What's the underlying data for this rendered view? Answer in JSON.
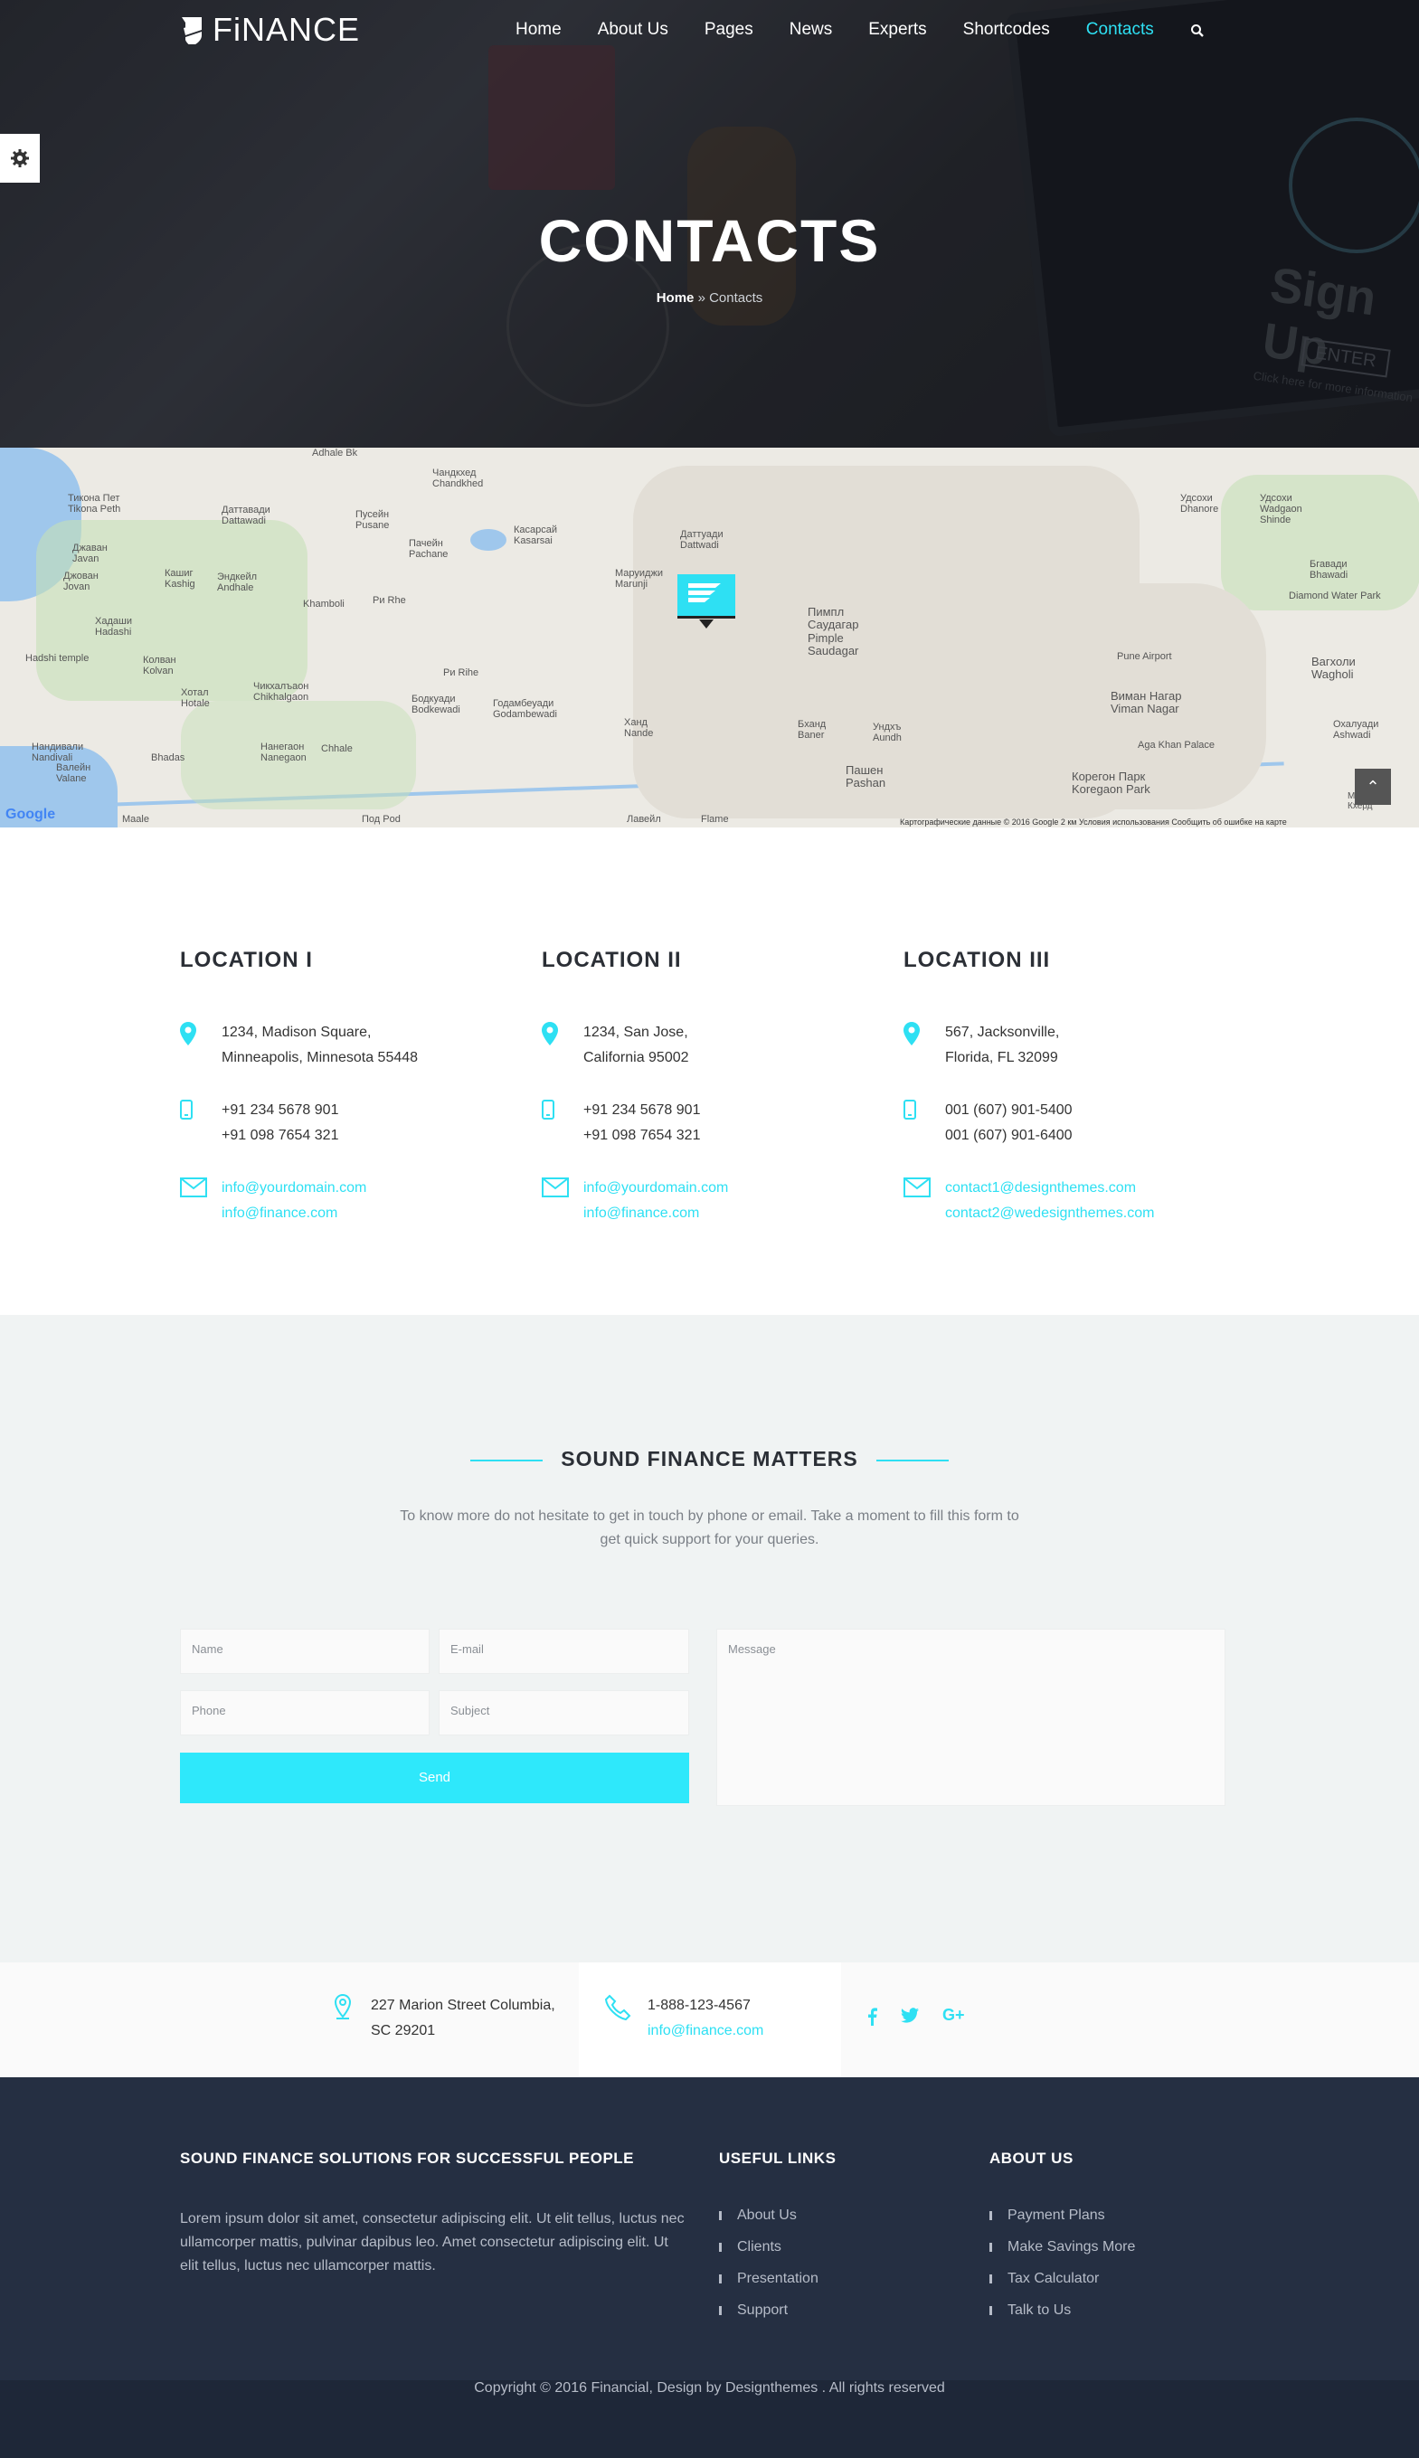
{
  "header": {
    "logo_text": "FiNANCE",
    "nav": [
      "Home",
      "About Us",
      "Pages",
      "News",
      "Experts",
      "Shortcodes",
      "Contacts"
    ],
    "active_nav": "Contacts",
    "search_icon": "search-icon"
  },
  "hero": {
    "title": "CONTACTS",
    "breadcrumb_home": "Home",
    "breadcrumb_sep": "»",
    "breadcrumb_current": "Contacts",
    "bg_text_signup": "Sign Up",
    "bg_text_enter": "ENTER",
    "bg_text_hint": "Click here for more information"
  },
  "map": {
    "labels": [
      "Adhale Bk",
      "Чандкхед Chandkhed",
      "Тиконa Пет Tikona Peth",
      "Даттавади Dattawadi",
      "Пусейн Pusane",
      "Пачейн Pachane",
      "Касарсай Kasarsai",
      "Даттуади Dattwadi",
      "Пимпл Саудагар Pimple Saudagar",
      "Маруиджи Marunji",
      "Джаван Javan",
      "Джован Jovan",
      "Кашиг Kashig",
      "Эндкейл Andhale",
      "Khamboli",
      "Ри Rhe",
      "Хадаши Hadashi",
      "Hadshi temple",
      "Колван Kolvan",
      "Хотал Hotale",
      "Чикхалъаон Chikhalgaon",
      "Ри Rihe",
      "Бодкуади Bodkewadi",
      "Годамбеуади Godambewadi",
      "Ханд Nande",
      "Бханд Baner",
      "Пашен Pashan",
      "Ундхъ Aundh",
      "Нанегаон Nanegaon",
      "Chhale",
      "Bhadas",
      "Валейн Valane",
      "Нандивали Nandivali",
      "Maale",
      "Под Pod",
      "Лавейл",
      "Flame",
      "Удсохи Dhanore",
      "Удсохи Wadgaon Shinde",
      "Бгавади Bhawadi",
      "Diamond Water Park",
      "Вагхоли Wagholi",
      "Pune Airport",
      "Виман Нагар Viman Nagar",
      "Aga Khan Palace",
      "Охалуади Ashwadi",
      "Корегон Парк Koregaon Park",
      "Мамжари Кхерд"
    ],
    "google": "Google",
    "attribution": "Картографические данные © 2016 Google   2 км   Условия использования   Сообщить об ошибке на карте"
  },
  "locations": [
    {
      "title": "LOCATION I",
      "address": [
        "1234, Madison Square,",
        "Minneapolis, Minnesota 55448"
      ],
      "phones": [
        "+91 234 5678 901",
        "+91 098 7654 321"
      ],
      "emails": [
        "info@yourdomain.com",
        "info@finance.com"
      ]
    },
    {
      "title": "LOCATION II",
      "address": [
        "1234, San Jose,",
        "California 95002"
      ],
      "phones": [
        "+91 234 5678 901",
        "+91 098 7654 321"
      ],
      "emails": [
        "info@yourdomain.com",
        "info@finance.com"
      ]
    },
    {
      "title": "LOCATION III",
      "address": [
        "567, Jacksonville,",
        "Florida, FL 32099"
      ],
      "phones": [
        "001 (607) 901-5400",
        "001 (607) 901-6400"
      ],
      "emails": [
        "contact1@designthemes.com",
        "contact2@wedesignthemes.com"
      ]
    }
  ],
  "contact_section": {
    "title": "SOUND FINANCE MATTERS",
    "subtitle": "To know more do not hesitate to get in touch by phone or email. Take a moment to fill this form to get quick support for your queries.",
    "name_placeholder": "Name",
    "email_placeholder": "E-mail",
    "phone_placeholder": "Phone",
    "subject_placeholder": "Subject",
    "message_placeholder": "Message",
    "send_label": "Send"
  },
  "strip": {
    "address": [
      "227 Marion Street Columbia,",
      "SC 29201"
    ],
    "phone": "1-888-123-4567",
    "email": "info@finance.com",
    "social": [
      "f",
      "t",
      "G+"
    ]
  },
  "footer": {
    "col1_title": "SOUND FINANCE SOLUTIONS FOR SUCCESSFUL PEOPLE",
    "col1_text": "Lorem ipsum dolor sit amet, consectetur adipiscing elit. Ut elit tellus, luctus nec ullamcorper mattis, pulvinar dapibus leo. Amet consectetur adipiscing elit. Ut elit tellus, luctus nec ullamcorper mattis.",
    "col2_title": "USEFUL LINKS",
    "col2_links": [
      "About Us",
      "Clients",
      "Presentation",
      "Support"
    ],
    "col3_title": "ABOUT US",
    "col3_links": [
      "Payment Plans",
      "Make Savings More",
      "Tax Calculator",
      "Talk to Us"
    ],
    "copyright": "Copyright © 2016 Financial, Design by Designthemes . All rights reserved"
  },
  "colors": {
    "accent": "#2ee0f3",
    "footer_bg": "#252f42",
    "copy_bg": "#1e2738",
    "section_bg": "#f0f3f3"
  }
}
